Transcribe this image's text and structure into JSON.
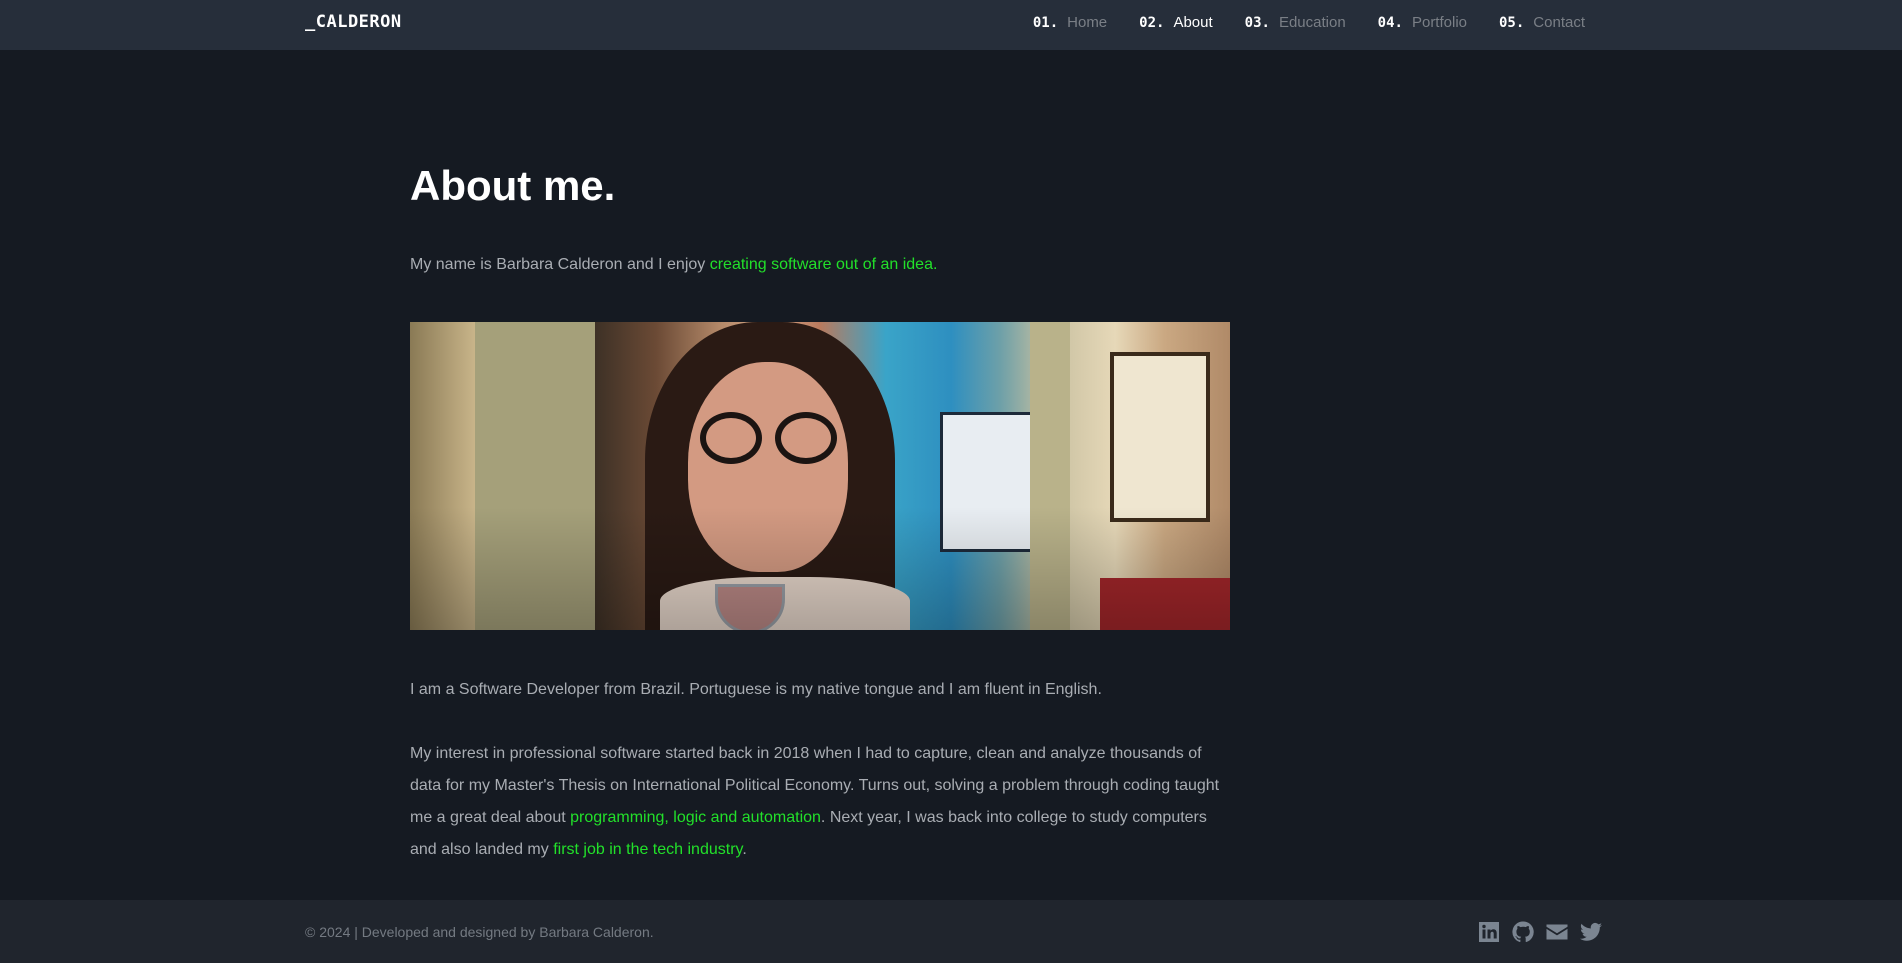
{
  "header": {
    "brand": "_CALDERON",
    "nav": [
      {
        "num": "01.",
        "label": "Home"
      },
      {
        "num": "02.",
        "label": "About"
      },
      {
        "num": "03.",
        "label": "Education"
      },
      {
        "num": "04.",
        "label": "Portfolio"
      },
      {
        "num": "05.",
        "label": "Contact"
      }
    ],
    "active_nav": "About"
  },
  "main": {
    "title": "About me.",
    "intro": {
      "text": "My name is Barbara Calderon and I enjoy ",
      "highlight": "creating software out of an idea."
    },
    "paragraph1": "I am a Software Developer from Brazil. Portuguese is my native tongue and I am fluent in English.",
    "paragraph2": {
      "part1": "My interest in professional software started back in 2018 when I had to capture, clean and analyze thousands of data for my Master's Thesis on International Political Economy. Turns out, solving a problem through coding taught me a great deal about ",
      "highlight1": "programming, logic and automation",
      "part2": ". Next year, I was back into college to study computers and also landed my ",
      "highlight2": "first job in the tech industry",
      "part3": "."
    }
  },
  "footer": {
    "copyright": "© 2024 | Developed and designed by Barbara Calderon.",
    "social_icons": [
      "linkedin-icon",
      "github-icon",
      "email-icon",
      "twitter-icon"
    ]
  },
  "colors": {
    "background": "#151a22",
    "header": "#262e3a",
    "footer": "#20252d",
    "accent": "#22e02a",
    "text": "#a9adb3"
  }
}
